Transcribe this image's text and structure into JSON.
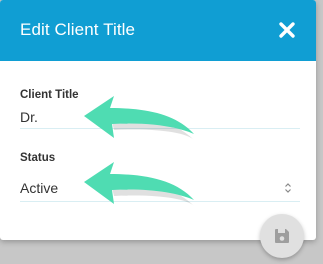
{
  "dialog": {
    "title": "Edit Client Title",
    "close_icon": "close-icon",
    "header_color": "#109ed3"
  },
  "fields": {
    "client_title": {
      "label": "Client Title",
      "value": "Dr."
    },
    "status": {
      "label": "Status",
      "value": "Active",
      "icon": "select-updown-icon"
    }
  },
  "actions": {
    "save_icon": "save-icon"
  },
  "annotations": {
    "arrow_color": "#4fdcb2"
  }
}
